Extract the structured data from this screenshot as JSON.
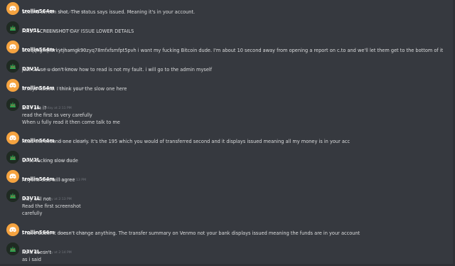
{
  "colors": {
    "background": "#36393f",
    "username": "#ffffff",
    "text": "#dcddde",
    "timestamp": "#72767d",
    "discord_avatar": "#f5a340"
  },
  "messages": [
    {
      "author": "trollin564m",
      "avatar": "discord-logo-icon",
      "timestamp": "Today at 2:04 PM",
      "lines": [
        "Second screen shot. The status says issued. Meaning it's in your account."
      ]
    },
    {
      "author": "D3V1L",
      "avatar": "d3vil-avatar-icon",
      "timestamp": "Today at 2:05 PM",
      "lines": [
        "FIRST SCREENSHOT DAY ISSUE LOWER DETAILS"
      ]
    },
    {
      "author": "trollin564m",
      "avatar": "discord-logo-icon",
      "timestamp": "Today at 2:07 PM",
      "lines": [
        "bc1qqhgnqlfzrkytjhamgk90zyq78mfxfsmfpt5pvh i want my fucking Bitcoin dude. I'm about 10 second away from opening a report on c.to and we'll let them get to the bottom of it"
      ]
    },
    {
      "author": "D3V1L",
      "avatar": "d3vil-avatar-icon",
      "timestamp": "Today at 2:08 PM",
      "lines": [
        "just cause u don't know how to read is not my fault. i will go to the admin myself"
      ]
    },
    {
      "author": "trollin564m",
      "avatar": "discord-logo-icon",
      "timestamp": "Today at 2:11 PM",
      "lines": [
        "It says issued. I think your the slow one here"
      ]
    },
    {
      "author": "D3V1L",
      "avatar": "d3vil-avatar-icon",
      "timestamp": "Today at 2:11 PM",
      "lines": [
        "am i am i?",
        "read the first ss very carefully",
        "When u fully read it then come talk to me"
      ]
    },
    {
      "author": "trollin564m",
      "avatar": "discord-logo-icon",
      "timestamp": "Today at 2:12 PM",
      "lines": [
        "Read the second one clearly. It's the 195 which you would of transferred second and it displays issued meaning all my money is in your acc"
      ]
    },
    {
      "author": "D3V1L",
      "avatar": "d3vil-avatar-icon",
      "timestamp": "Today at 2:12 PM",
      "lines": [
        "Ur so fucking slow dude"
      ]
    },
    {
      "author": "trollin564m",
      "avatar": "discord-logo-icon",
      "timestamp": "Today at 2:13 PM",
      "lines": [
        "Anyone else will agree"
      ]
    },
    {
      "author": "D3V1L",
      "avatar": "d3vil-avatar-icon",
      "timestamp": "Today at 2:13 PM",
      "lines": [
        "they will not",
        "Read the first screenshot",
        "carefully"
      ]
    },
    {
      "author": "trollin564m",
      "avatar": "discord-logo-icon",
      "timestamp": "Today at 2:14 PM",
      "lines": [
        "I have dude. It doesn't change anything. The transfer summary on Venmo not your bank displays issued meaning the funds are in your account"
      ]
    },
    {
      "author": "D3V1L",
      "avatar": "d3vil-avatar-icon",
      "timestamp": "Today at 2:14 PM",
      "lines": [
        "no it doesn't",
        "as i said"
      ]
    }
  ]
}
